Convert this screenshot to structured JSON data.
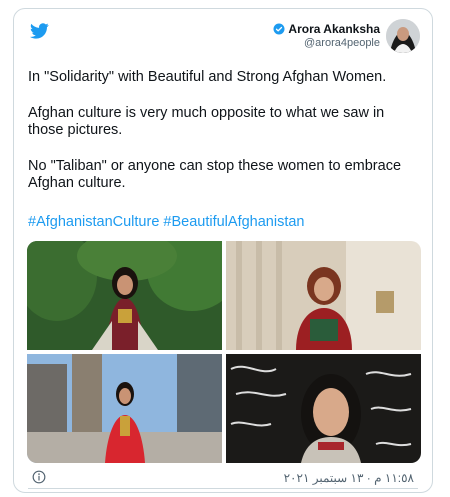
{
  "header": {
    "logo_icon": "twitter-bird-icon",
    "author_name": "Arora Akanksha",
    "author_handle": "@arora4people",
    "verified_icon": "verified-badge-icon",
    "brand_color": "#1d9bf0"
  },
  "tweet": {
    "paragraphs": [
      "In \"Solidarity\" with Beautiful and Strong Afghan Women.",
      "Afghan culture is very much opposite to what we saw in those pictures.",
      "No \"Taliban\" or anyone can stop these women to embrace Afghan culture."
    ],
    "hashtags": [
      "#AfghanistanCulture",
      "#BeautifulAfghanistan"
    ]
  },
  "media": {
    "photos": [
      "photo-woman-in-park",
      "photo-woman-indoors",
      "photo-woman-on-street",
      "photo-woman-calligraphy-background"
    ]
  },
  "footer": {
    "info_icon": "info-icon",
    "timestamp": "١١:٥٨ م · ١٣ سبتمبر ٢٠٢١"
  }
}
